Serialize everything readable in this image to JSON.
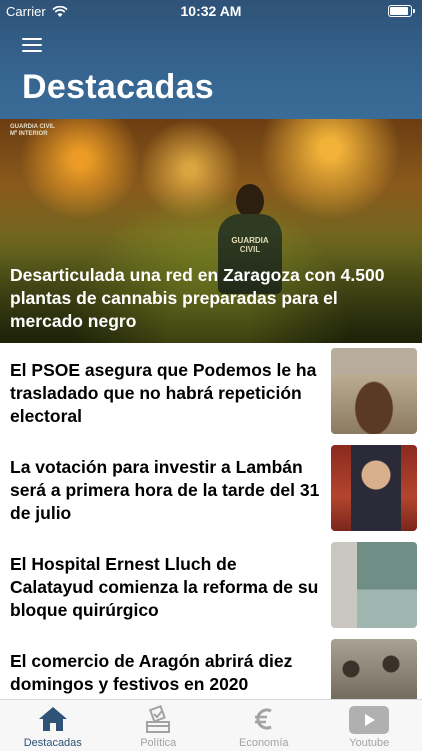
{
  "status_bar": {
    "carrier": "Carrier",
    "time": "10:32 AM"
  },
  "header": {
    "title": "Destacadas",
    "menu_icon": "hamburger-menu-icon"
  },
  "hero": {
    "title": "Desarticulada una red en Zaragoza con 4.500 plantas de cannabis preparadas para el mercado negro",
    "watermark": "GUARDIA CIVIL\nMº INTERIOR",
    "badge": "GUARDIA\nCIVIL"
  },
  "news": [
    {
      "title": "El PSOE asegura que Podemos le ha trasladado que no habrá repetición electoral"
    },
    {
      "title": "La votación para investir a Lambán será a primera hora de la tarde del 31 de julio"
    },
    {
      "title": "El Hospital Ernest Lluch de Calatayud comienza la reforma de su bloque quirúrgico"
    },
    {
      "title": "El comercio de Aragón abrirá diez domingos y festivos en 2020"
    }
  ],
  "tabs": [
    {
      "label": "Destacadas",
      "icon": "home-icon",
      "active": true
    },
    {
      "label": "Política",
      "icon": "ballot-box-icon",
      "active": false
    },
    {
      "label": "Economía",
      "icon": "euro-icon",
      "active": false
    },
    {
      "label": "Youtube",
      "icon": "youtube-icon",
      "active": false
    }
  ],
  "colors": {
    "header": "#2f5277",
    "active_tab": "#2f5277",
    "inactive_tab": "#a3a3a3"
  }
}
